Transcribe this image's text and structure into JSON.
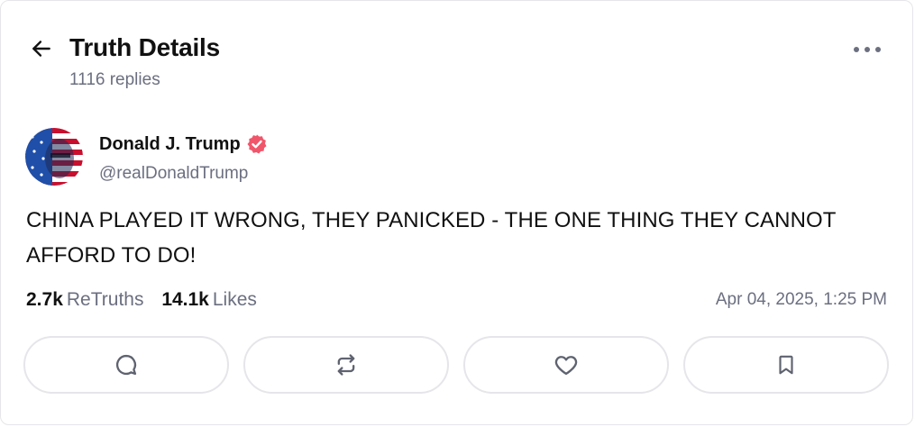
{
  "header": {
    "title": "Truth Details",
    "replies": "1116 replies",
    "back_icon": "arrow-left-icon",
    "more_icon": "more-horizontal-icon"
  },
  "post": {
    "author": {
      "name": "Donald J. Trump",
      "handle": "@realDonaldTrump",
      "verified_color": "#f0566b"
    },
    "text": "CHINA PLAYED IT WRONG, THEY PANICKED - THE ONE THING THEY CANNOT AFFORD TO DO!",
    "stats": {
      "retruths_count": "2.7k",
      "retruths_label": "ReTruths",
      "likes_count": "14.1k",
      "likes_label": "Likes"
    },
    "date": "Apr 04, 2025, 1:25 PM"
  },
  "actions": [
    {
      "icon": "reply-icon"
    },
    {
      "icon": "retruth-icon"
    },
    {
      "icon": "like-icon"
    },
    {
      "icon": "bookmark-icon"
    }
  ],
  "colors": {
    "text_primary": "#111111",
    "text_secondary": "#6b6f80",
    "border": "#e6e6ea",
    "icon": "#5f6370"
  }
}
